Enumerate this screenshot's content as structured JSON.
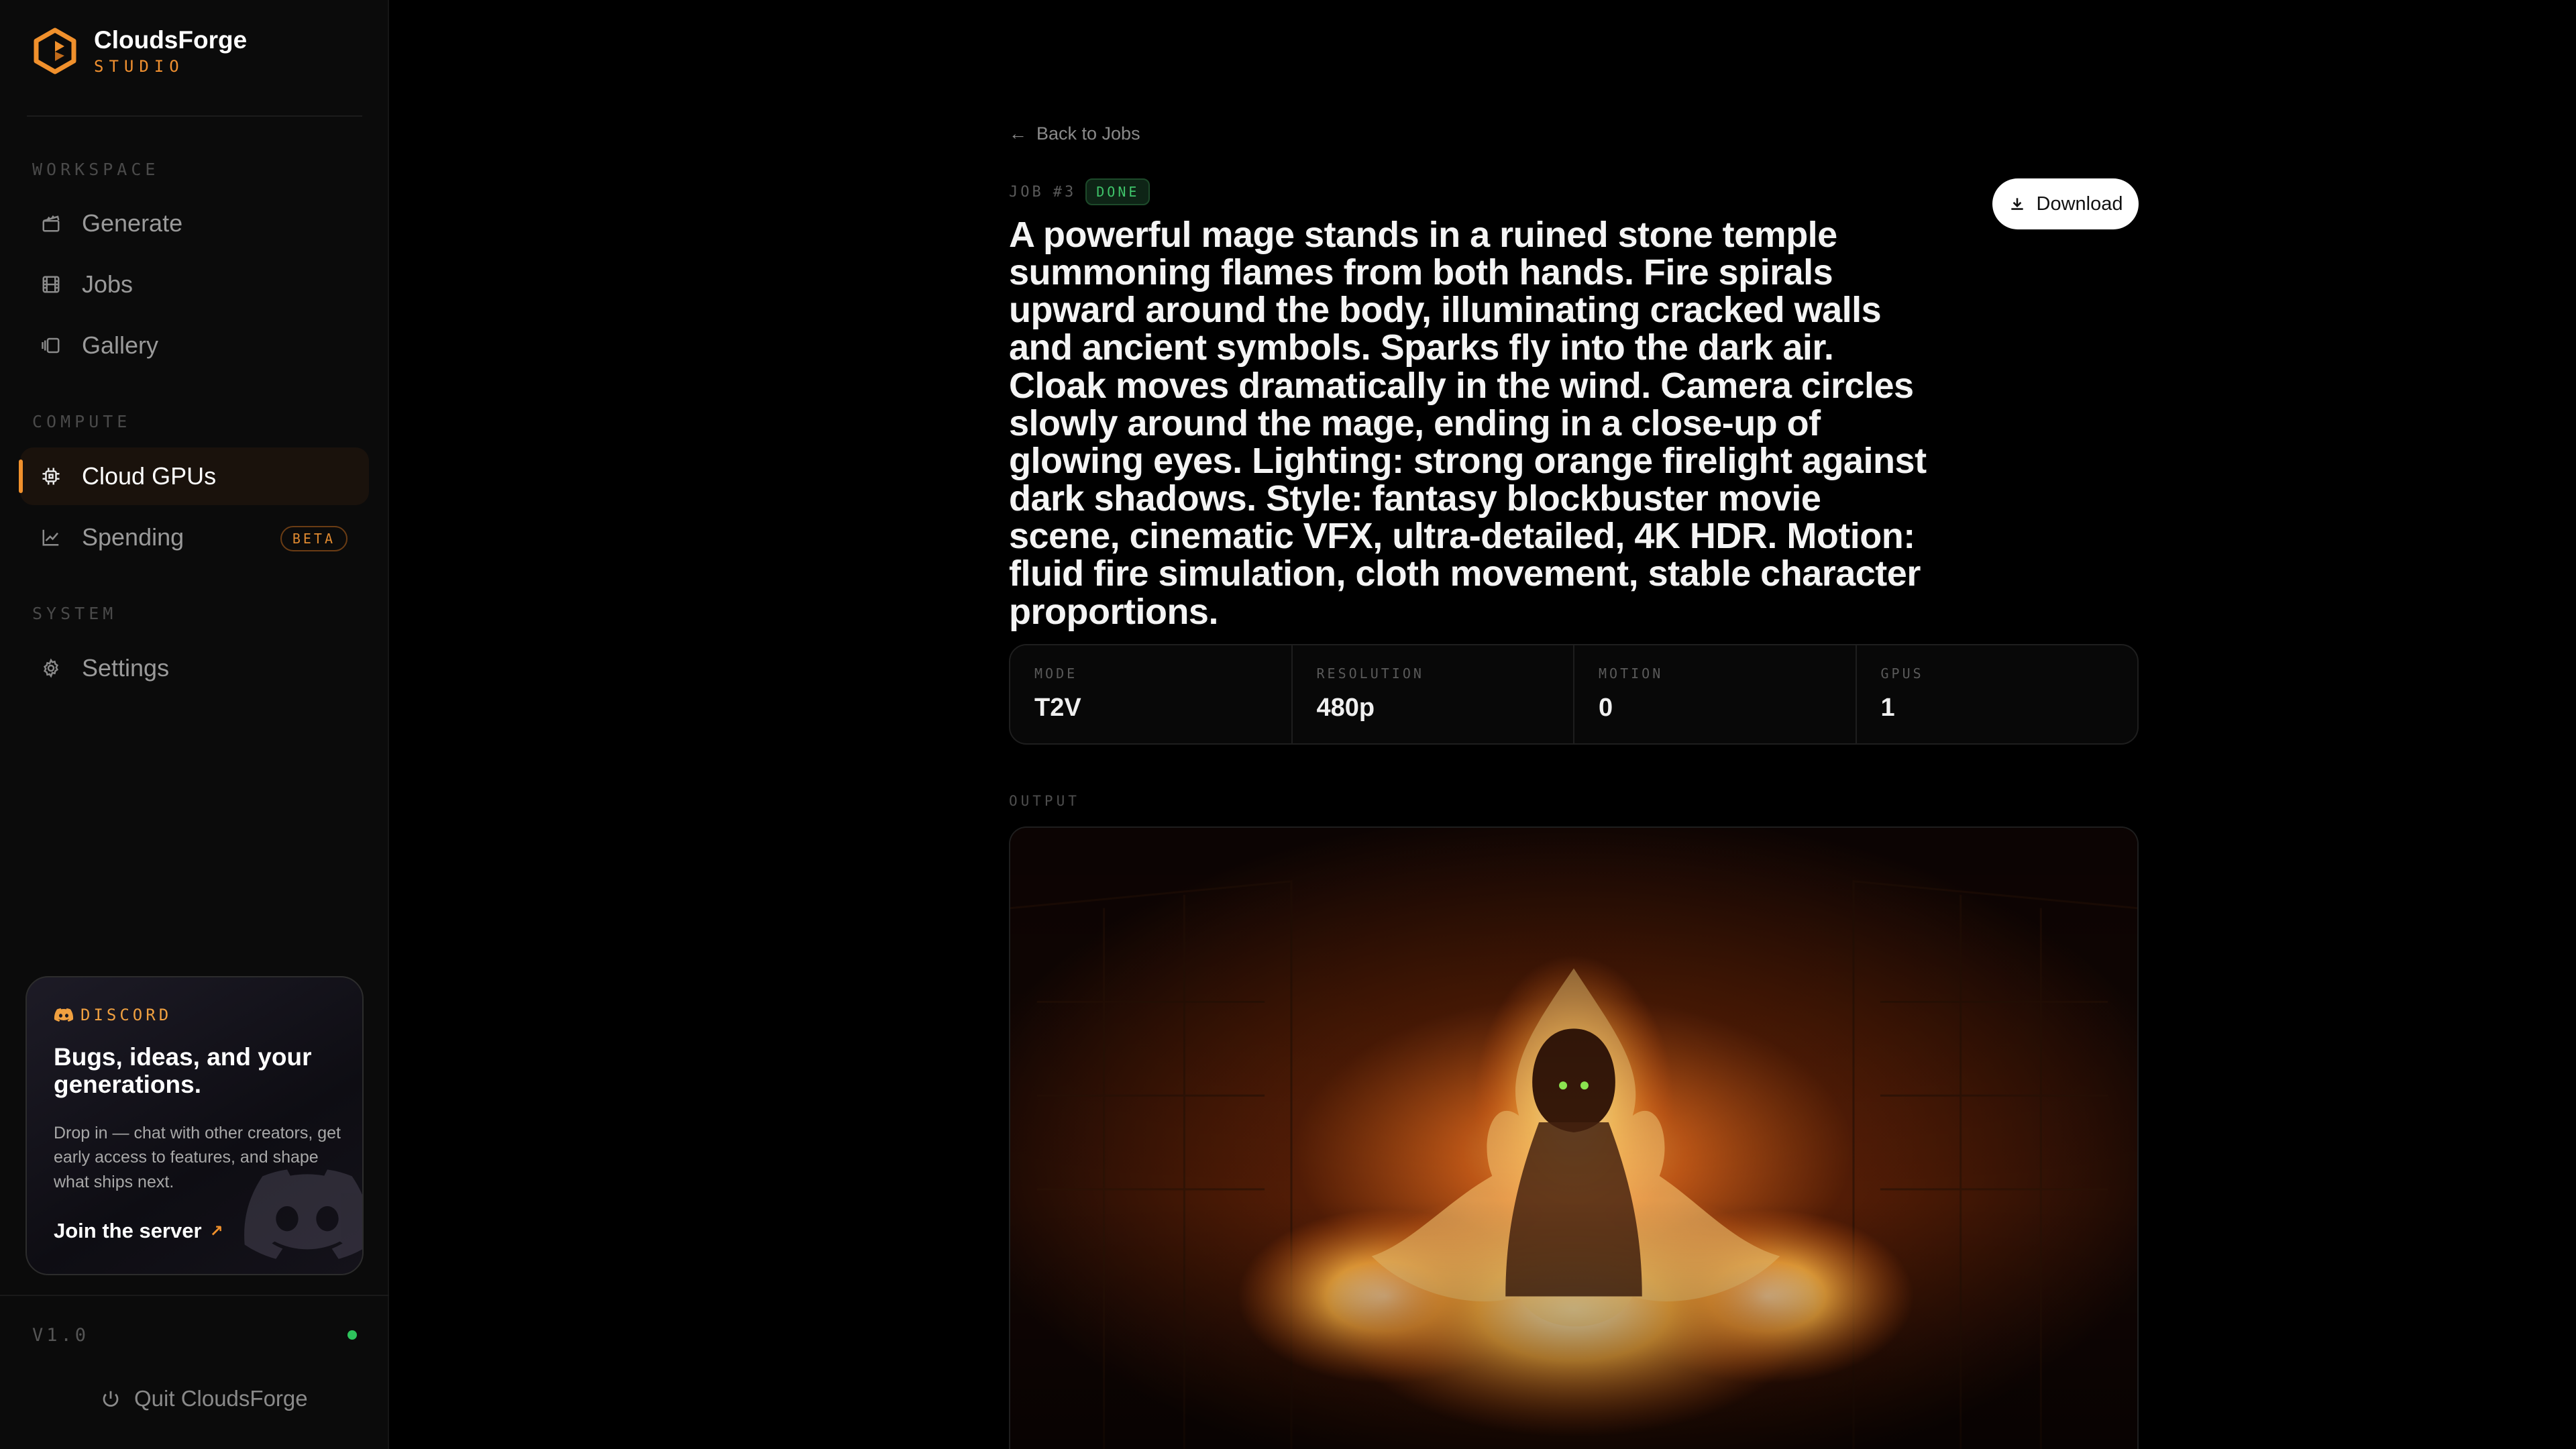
{
  "brand": {
    "name": "CloudsForge",
    "sub": "STUDIO",
    "accent": "#f09030"
  },
  "sidebar": {
    "sections": {
      "workspace": "WORKSPACE",
      "compute": "COMPUTE",
      "system": "SYSTEM"
    },
    "items": [
      {
        "label": "Generate",
        "icon": "clapper-icon"
      },
      {
        "label": "Jobs",
        "icon": "film-icon"
      },
      {
        "label": "Gallery",
        "icon": "gallery-icon"
      },
      {
        "label": "Cloud GPUs",
        "icon": "chip-icon",
        "active": true
      },
      {
        "label": "Spending",
        "icon": "chart-icon",
        "badge": "BETA"
      },
      {
        "label": "Settings",
        "icon": "gear-icon"
      }
    ],
    "discord": {
      "tag": "DISCORD",
      "title": "Bugs, ideas, and your generations.",
      "body": "Drop in — chat with other creators, get early access to features, and shape what ships next.",
      "cta": "Join the server"
    },
    "version": "V1.0",
    "quit": "Quit CloudsForge"
  },
  "main": {
    "back": "Back to Jobs",
    "job_label": "JOB",
    "job_number": "#3",
    "status": "DONE",
    "download": "Download",
    "prompt": "A powerful mage stands in a ruined stone temple summoning flames from both hands. Fire spirals upward around the body, illuminating cracked walls and ancient symbols. Sparks fly into the dark air. Cloak moves dramatically in the wind. Camera circles slowly around the mage, ending in a close-up of glowing eyes. Lighting: strong orange firelight against dark shadows. Style: fantasy blockbuster movie scene, cinematic VFX, ultra-detailed, 4K HDR. Motion: fluid fire simulation, cloth movement, stable character proportions.",
    "stats": [
      {
        "label": "MODE",
        "value": "T2V"
      },
      {
        "label": "RESOLUTION",
        "value": "480p"
      },
      {
        "label": "MOTION",
        "value": "0"
      },
      {
        "label": "GPUS",
        "value": "1"
      }
    ],
    "output_label": "OUTPUT"
  }
}
